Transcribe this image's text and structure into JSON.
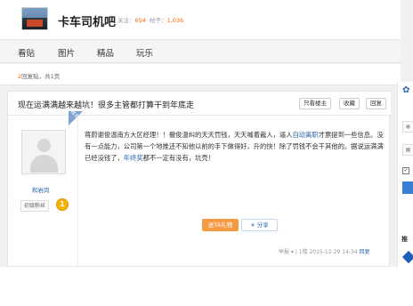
{
  "header": {
    "forum_name": "卡车司机吧",
    "follow_label": "关注：",
    "follow_count": "654",
    "posts_label": "帖子：",
    "posts_count": "1,036"
  },
  "nav": {
    "items": [
      "看贴",
      "图片",
      "精品",
      "玩乐"
    ]
  },
  "pager": {
    "reply_count": "2",
    "text": "回复贴，共1页"
  },
  "thread": {
    "title": "现在运满满越来越坑！很多主管都打算干到年底走",
    "buttons": [
      "只看楼主",
      "收藏",
      "回复"
    ]
  },
  "post": {
    "author": "和岩岗",
    "rank": "初级粉丝",
    "rank_level": "1",
    "corner_tag": "楼主",
    "content_part1": "蒋蔚谢俊温南方大区经理！！撒俊温纠的天天罚钱，天天喊着裁人，逼人",
    "content_link1": "自动离职",
    "content_part2": "才票提到一些信息。没有一点能力，公司第一个地推还不知他以前的手下做得好，升的快！除了罚钱不会干其他的。据说运满满已经没钱了，",
    "content_link2": "年终奖",
    "content_part3": "都不一定有没有，坑壳！",
    "btn_ta": "送TA礼物",
    "btn_share": "分享",
    "meta_prefix": "举报 ▾ | 1楼  2015-12-29 14:34",
    "meta_reply": "回复"
  },
  "right_panel": {
    "recommend_label": "推"
  }
}
